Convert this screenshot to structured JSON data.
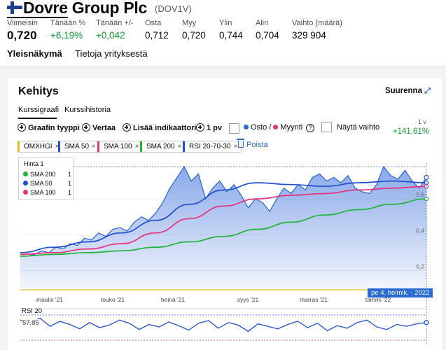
{
  "header": {
    "company": "Dovre Group Plc",
    "ticker": "(DOV1V)",
    "stats": [
      {
        "label": "Viimeisin",
        "value": "0,720"
      },
      {
        "label": "Tänään %",
        "value": "+6,19%"
      },
      {
        "label": "Tänään +/-",
        "value": "+0,042"
      },
      {
        "label": "Osta",
        "value": "0,712"
      },
      {
        "label": "Myy",
        "value": "0,720"
      },
      {
        "label": "Ylin",
        "value": "0,744"
      },
      {
        "label": "Alin",
        "value": "0,704"
      },
      {
        "label": "Vaihto (määrä)",
        "value": "329 904"
      }
    ],
    "tabs": [
      "Yleisnäkymä",
      "Tietoja yrityksestä"
    ]
  },
  "card": {
    "title": "Kehitys",
    "enlarge": "Suurenna",
    "subtabs": [
      "Kurssigraafi",
      "Kurssihistoria"
    ],
    "toolbar": {
      "chart_type": "Graafin tyyppi",
      "compare": "Vertaa",
      "add_indicator": "Lisää indikaattori",
      "interval": "1 pv",
      "buy": "Osto",
      "sep": "/",
      "sell": "Myynti",
      "show_turnover": "Näytä vaihto",
      "help": "?"
    },
    "period": "1 v",
    "change": "+141,61%",
    "chips": [
      "OMXHGI",
      "SMA 50",
      "SMA 100",
      "SMA 200",
      "RSI 20-70-30"
    ],
    "chip_close": "×",
    "remove": "Poista",
    "legend": {
      "header": "Hinta",
      "header_value": "1",
      "rows": [
        {
          "name": "SMA 200",
          "value": "1",
          "color": "#22b43a"
        },
        {
          "name": "SMA  50",
          "value": "1",
          "color": "#1f4ed1"
        },
        {
          "name": "SMA 100",
          "value": "1",
          "color": "#e6327a"
        }
      ]
    },
    "date_badge": "pe 4. helmik. - 2022",
    "rsi_label": "RSI 20",
    "rsi_value": "57,85"
  },
  "colors": {
    "price": "#2a63d9",
    "sma50": "#1f4ed1",
    "sma100": "#e6327a",
    "sma200": "#22b43a",
    "omxhgi": "#e8b92a",
    "positive": "#0b9e2c",
    "accent": "#2a6bd1"
  },
  "chart_data": {
    "type": "line",
    "x_ticks": [
      "maalis '21",
      "touko '21",
      "heinä '21",
      "syys '21",
      "marras '21",
      "tammi '22"
    ],
    "y_ticks": [
      "0,2",
      "0,4",
      "0,6"
    ],
    "ylim": [
      0.1,
      0.8
    ],
    "grid": true,
    "series": [
      {
        "name": "SMA 200",
        "color": "#22b43a",
        "values": [
          0.28,
          0.29,
          0.3,
          0.31,
          0.33,
          0.36,
          0.39,
          0.43,
          0.47,
          0.51,
          0.54,
          0.57,
          0.6
        ]
      },
      {
        "name": "SMA 50",
        "color": "#1f4ed1",
        "values": [
          0.3,
          0.33,
          0.36,
          0.41,
          0.48,
          0.57,
          0.65,
          0.69,
          0.68,
          0.67,
          0.69,
          0.7,
          0.69
        ]
      },
      {
        "name": "SMA 100",
        "color": "#e6327a",
        "values": [
          0.29,
          0.3,
          0.32,
          0.35,
          0.41,
          0.49,
          0.56,
          0.6,
          0.62,
          0.63,
          0.65,
          0.66,
          0.67
        ]
      }
    ],
    "price": [
      0.28,
      0.28,
      0.29,
      0.31,
      0.3,
      0.33,
      0.32,
      0.35,
      0.34,
      0.38,
      0.37,
      0.41,
      0.39,
      0.43,
      0.44,
      0.42,
      0.47,
      0.5,
      0.48,
      0.52,
      0.58,
      0.66,
      0.72,
      0.78,
      0.7,
      0.74,
      0.6,
      0.66,
      0.7,
      0.64,
      0.68,
      0.62,
      0.55,
      0.6,
      0.58,
      0.53,
      0.6,
      0.66,
      0.63,
      0.68,
      0.65,
      0.72,
      0.74,
      0.7,
      0.72,
      0.69,
      0.73,
      0.66,
      0.64,
      0.63,
      0.68,
      0.78,
      0.73,
      0.71,
      0.76,
      0.7,
      0.66,
      0.72
    ],
    "omxhgi_baseline": true,
    "rsi": [
      62,
      58,
      65,
      52,
      60,
      55,
      48,
      58,
      50,
      54,
      62,
      57,
      47,
      55,
      51,
      59,
      53,
      46,
      57,
      61,
      49,
      58,
      54,
      44,
      56,
      52,
      48,
      55,
      60,
      50,
      57,
      45,
      53,
      49,
      58,
      62,
      51,
      47,
      55,
      52,
      56,
      58
    ],
    "rsi_levels": [
      70,
      30
    ]
  }
}
